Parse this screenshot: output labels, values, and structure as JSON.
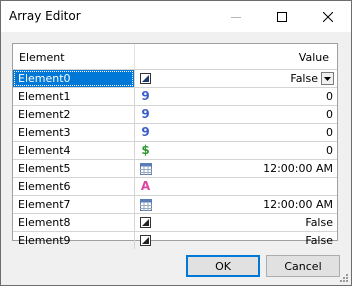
{
  "window": {
    "title": "Array Editor",
    "buttons": {
      "ok": "OK",
      "cancel": "Cancel"
    }
  },
  "grid": {
    "headers": {
      "element": "Element",
      "value": "Value"
    },
    "rows": [
      {
        "name": "Element0",
        "value": "False",
        "icon": "checkbox-icon",
        "dropdown": true,
        "selected": true
      },
      {
        "name": "Element1",
        "value": "0",
        "icon": "number-nine-icon"
      },
      {
        "name": "Element2",
        "value": "0",
        "icon": "number-nine-icon"
      },
      {
        "name": "Element3",
        "value": "0",
        "icon": "number-nine-icon"
      },
      {
        "name": "Element4",
        "value": "0",
        "icon": "dollar-icon"
      },
      {
        "name": "Element5",
        "value": "12:00:00 AM",
        "icon": "calendar-icon"
      },
      {
        "name": "Element6",
        "value": "",
        "icon": "letter-a-icon"
      },
      {
        "name": "Element7",
        "value": "12:00:00 AM",
        "icon": "calendar-icon"
      },
      {
        "name": "Element8",
        "value": "False",
        "icon": "checkbox-icon"
      },
      {
        "name": "Element9",
        "value": "False",
        "icon": "checkbox-icon"
      }
    ]
  },
  "colors": {
    "selection": "#0078d7",
    "number_icon": "#3a5fcd",
    "dollar_icon": "#2e9a2e",
    "letter_icon": "#e040a0"
  }
}
